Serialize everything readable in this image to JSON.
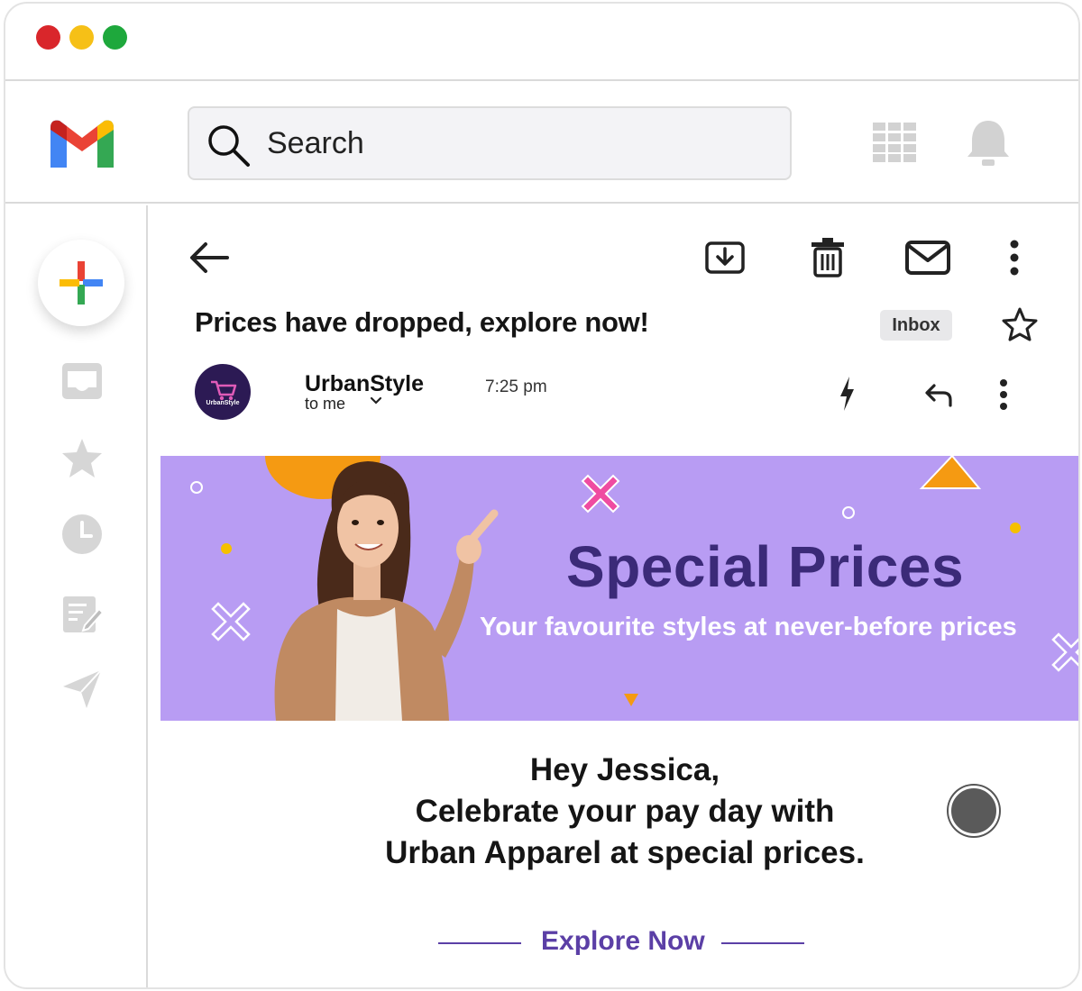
{
  "search": {
    "placeholder": "Search"
  },
  "email": {
    "subject": "Prices have dropped, explore now!",
    "folder_badge": "Inbox",
    "sender": "UrbanStyle",
    "recipient": "to me",
    "time": "7:25 pm",
    "avatar_text": "UrbanStyle"
  },
  "banner": {
    "title": "Special Prices",
    "subtitle": "Your favourite styles at never-before prices"
  },
  "body": {
    "line1": "Hey Jessica,",
    "line2": "Celebrate your pay day with",
    "line3": "Urban Apparel at special prices."
  },
  "cta": {
    "label": "Explore Now"
  },
  "colors": {
    "banner_bg": "#b89cf3",
    "banner_title": "#3b2a78",
    "accent_purple": "#5b3fa6",
    "traffic_red": "#d9262b",
    "traffic_yellow": "#f6c017",
    "traffic_green": "#1ea83c"
  },
  "icons": {
    "toolbar": [
      "back-arrow-icon",
      "archive-icon",
      "trash-icon",
      "mail-icon",
      "more-vert-icon"
    ],
    "sidebar": [
      "compose-plus-icon",
      "inbox-icon",
      "star-icon",
      "clock-icon",
      "drafts-icon",
      "send-icon"
    ],
    "header": [
      "search-icon",
      "apps-grid-icon",
      "bell-icon"
    ]
  }
}
